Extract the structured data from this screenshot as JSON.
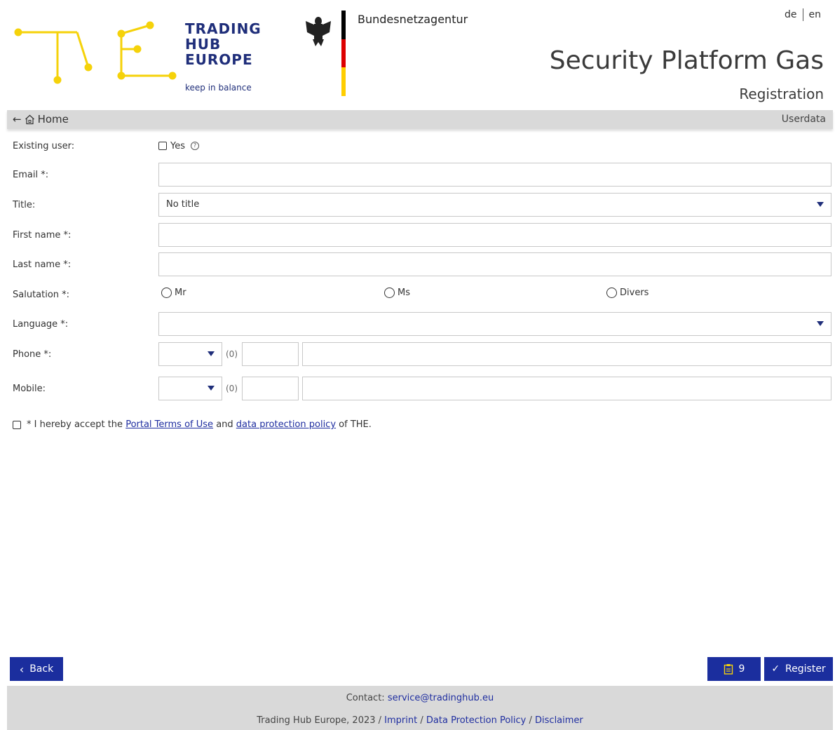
{
  "header": {
    "logo_lines": [
      "TRADING",
      "HUB",
      "EUROPE"
    ],
    "logo_tagline": "keep in balance",
    "agency": "Bundesnetzagentur",
    "lang_de": "de",
    "lang_en": "en",
    "app_title": "Security Platform Gas",
    "subtitle": "Registration",
    "colors": {
      "brand_blue": "#1f2e7a",
      "logo_yellow": "#f5d20a",
      "button_blue": "#1b2e9e"
    }
  },
  "nav": {
    "home_label": "Home",
    "crumb_right": "Userdata"
  },
  "form": {
    "existing_user_label": "Existing user:",
    "existing_user_option": "Yes",
    "email_label": "Email *:",
    "email_value": "",
    "title_label": "Title:",
    "title_value": "No title",
    "first_name_label": "First name *:",
    "first_name_value": "",
    "last_name_label": "Last name *:",
    "last_name_value": "",
    "salutation_label": "Salutation *:",
    "salutation_options": [
      "Mr",
      "Ms",
      "Divers"
    ],
    "language_label": "Language *:",
    "language_value": "",
    "phone_label": "Phone *:",
    "mobile_label": "Mobile:",
    "trunk_prefix": "(0)",
    "terms_prefix": "* I hereby accept the",
    "terms_link1": "Portal Terms of Use",
    "terms_and": "and",
    "terms_link2": "data protection policy",
    "terms_suffix": "of THE."
  },
  "actions": {
    "back_label": "Back",
    "clipboard_count": "9",
    "register_label": "Register"
  },
  "footer": {
    "contact_prefix": "Contact:",
    "contact_email": "service@tradinghub.eu",
    "company": "Trading Hub Europe, 2023 /",
    "imprint": "Imprint",
    "data_policy": "Data Protection Policy",
    "disclaimer": "Disclaimer",
    "sep": "/"
  }
}
